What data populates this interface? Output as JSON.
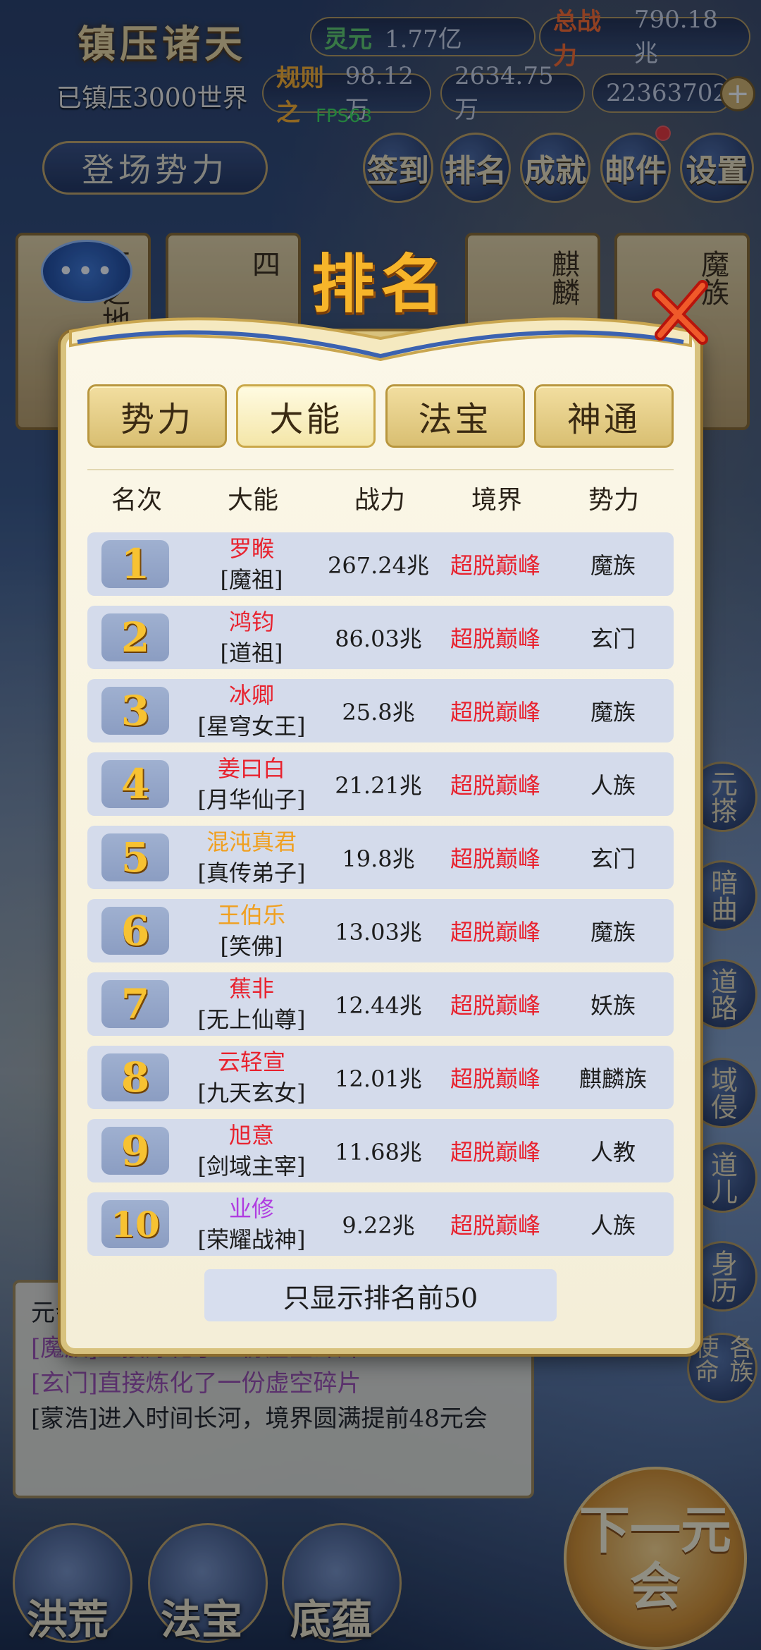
{
  "hud": {
    "game_title": "镇压诸天",
    "lingyuan_label": "灵元",
    "lingyuan_value": "1.77亿",
    "power_label": "总战力",
    "power_value": "790.18兆",
    "suppressed_text": "已镇压3000世界",
    "rule_label": "规则之",
    "rule_value": "98.12万",
    "stat_b": "2634.75万",
    "stat_c": "22363702",
    "fps": "FPS63",
    "enter_label": "登场势力",
    "buttons": [
      "签到",
      "排名",
      "成就",
      "邮件",
      "设置"
    ]
  },
  "background": {
    "cards": [
      "西之地",
      "四",
      "麒麟",
      "魔族"
    ],
    "side_buttons": [
      "元搽",
      "暗曲",
      "道路",
      "域侵",
      "道儿",
      "身历",
      "各族使命"
    ]
  },
  "log": {
    "lines": [
      {
        "text": "元会",
        "color": "#222"
      },
      {
        "text": "[魔族]直接炼化了一份虚空碎片",
        "color": "#a04fb0"
      },
      {
        "text": "[玄门]直接炼化了一份虚空碎片",
        "color": "#a04fb0"
      },
      {
        "text": "[蒙浩]进入时间长河，境界圆满提前48元会",
        "color": "#222"
      }
    ]
  },
  "bottom_nav": {
    "items": [
      "洪荒",
      "法宝",
      "底蕴"
    ],
    "next_label": "下一元会"
  },
  "modal": {
    "title": "排名",
    "tabs": [
      "势力",
      "大能",
      "法宝",
      "神通"
    ],
    "active_tab": "大能",
    "columns": [
      "名次",
      "大能",
      "战力",
      "境界",
      "势力"
    ],
    "rows": [
      {
        "rank": "1",
        "name": "罗睺",
        "name_color": "#e8222e",
        "title": "[魔祖]",
        "power": "267.24兆",
        "realm": "超脱巅峰",
        "faction": "魔族"
      },
      {
        "rank": "2",
        "name": "鸿钧",
        "name_color": "#e8222e",
        "title": "[道祖]",
        "power": "86.03兆",
        "realm": "超脱巅峰",
        "faction": "玄门"
      },
      {
        "rank": "3",
        "name": "冰卿",
        "name_color": "#e8222e",
        "title": "[星穹女王]",
        "power": "25.8兆",
        "realm": "超脱巅峰",
        "faction": "魔族"
      },
      {
        "rank": "4",
        "name": "姜曰白",
        "name_color": "#e8222e",
        "title": "[月华仙子]",
        "power": "21.21兆",
        "realm": "超脱巅峰",
        "faction": "人族"
      },
      {
        "rank": "5",
        "name": "混沌真君",
        "name_color": "#f0a020",
        "title": "[真传弟子]",
        "power": "19.8兆",
        "realm": "超脱巅峰",
        "faction": "玄门"
      },
      {
        "rank": "6",
        "name": "王伯乐",
        "name_color": "#f0a020",
        "title": "[笑佛]",
        "power": "13.03兆",
        "realm": "超脱巅峰",
        "faction": "魔族"
      },
      {
        "rank": "7",
        "name": "蕉非",
        "name_color": "#e8222e",
        "title": "[无上仙尊]",
        "power": "12.44兆",
        "realm": "超脱巅峰",
        "faction": "妖族"
      },
      {
        "rank": "8",
        "name": "云轻宣",
        "name_color": "#e8222e",
        "title": "[九天玄女]",
        "power": "12.01兆",
        "realm": "超脱巅峰",
        "faction": "麒麟族"
      },
      {
        "rank": "9",
        "name": "旭意",
        "name_color": "#e8222e",
        "title": "[剑域主宰]",
        "power": "11.68兆",
        "realm": "超脱巅峰",
        "faction": "人教"
      },
      {
        "rank": "10",
        "name": "业修",
        "name_color": "#b03ce0",
        "title": "[荣耀战神]",
        "power": "9.22兆",
        "realm": "超脱巅峰",
        "faction": "人族"
      }
    ],
    "footer_note": "只显示排名前50"
  },
  "colors": {
    "accent_gold": "#f7b52a",
    "realm_red": "#e8222e",
    "row_bg": "#d4dbeb"
  }
}
